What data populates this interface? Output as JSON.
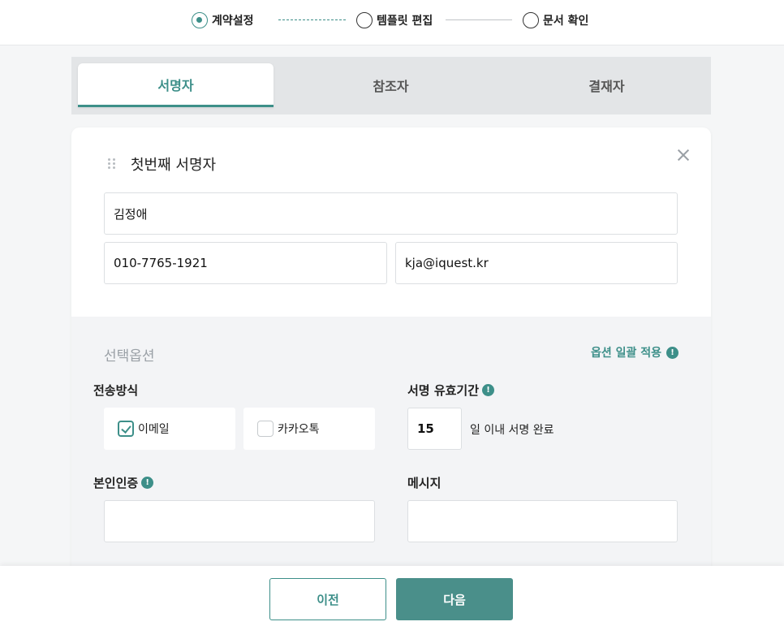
{
  "stepper": {
    "steps": [
      {
        "label": "계약설정",
        "active": true
      },
      {
        "label": "템플릿 편집",
        "active": false
      },
      {
        "label": "문서 확인",
        "active": false
      }
    ]
  },
  "tabs": [
    {
      "label": "서명자",
      "active": true
    },
    {
      "label": "참조자",
      "active": false
    },
    {
      "label": "결재자",
      "active": false
    }
  ],
  "signer": {
    "title": "첫번째 서명자",
    "name": "김정애",
    "phone": "010-7765-1921",
    "email": "kja@iquest.kr"
  },
  "options": {
    "heading": "선택옵션",
    "bulk_apply": "옵션 일괄 적용",
    "send_method": {
      "label": "전송방식",
      "choices": [
        {
          "label": "이메일",
          "checked": true
        },
        {
          "label": "카카오톡",
          "checked": false
        }
      ]
    },
    "validity": {
      "label": "서명 유효기간",
      "days": "15",
      "suffix": "일 이내 서명 완료"
    },
    "identity": {
      "label": "본인인증",
      "value": ""
    },
    "message": {
      "label": "메시지",
      "value": ""
    }
  },
  "footer": {
    "prev_label": "이전",
    "next_label": "다음"
  },
  "colors": {
    "accent": "#3d8f89",
    "next_button": "#4a8f8a"
  },
  "icons": {
    "info": "!"
  }
}
